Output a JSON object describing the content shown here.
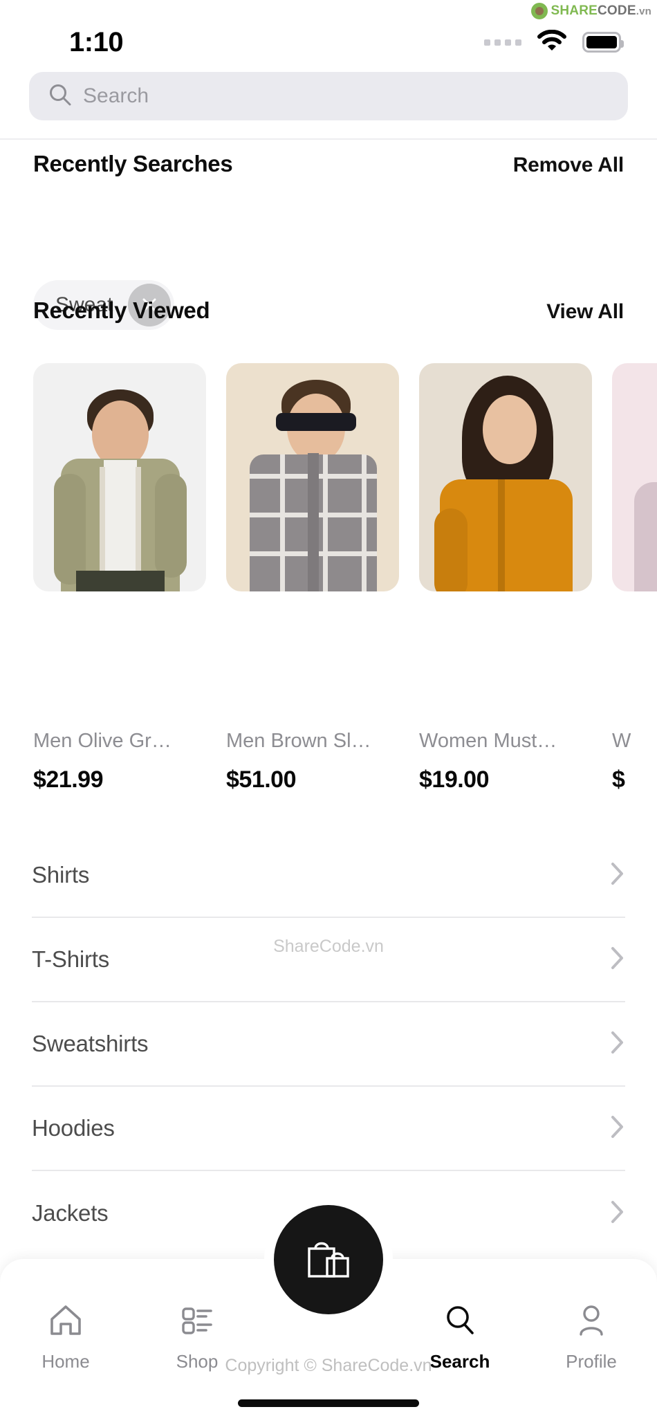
{
  "watermark": {
    "logo_share": "SHARE",
    "logo_code": "CODE",
    "logo_tld": ".vn",
    "logo_icon": "recycle-icon",
    "top_text": "ShareCode.vn",
    "bottom_text": "Copyright © ShareCode.vn"
  },
  "statusbar": {
    "time": "1:10",
    "signal_icon": "signal-dots-icon",
    "wifi_icon": "wifi-icon",
    "battery_icon": "battery-full-icon"
  },
  "search": {
    "placeholder": "Search",
    "value": "",
    "icon": "search-icon"
  },
  "recent_searches": {
    "title": "Recently Searches",
    "action": "Remove All",
    "chips": [
      {
        "label": "Sweat",
        "close_icon": "close-icon"
      }
    ]
  },
  "recently_viewed": {
    "title": "Recently Viewed",
    "action": "View All",
    "products": [
      {
        "title": "Men Olive Gr…",
        "price": "$21.99",
        "bg": "#f1f1f1",
        "garment": "#a7a581",
        "skin": "#e0b392",
        "hair": "#3a2a1e"
      },
      {
        "title": "Men Brown Sl…",
        "price": "$51.00",
        "bg": "#ece0cd",
        "garment": "#8e8a8c",
        "skin": "#e6bd9c",
        "hair": "#4a3422"
      },
      {
        "title": "Women Must…",
        "price": "$19.00",
        "bg": "#e6ded2",
        "garment": "#d8890f",
        "skin": "#e8c1a1",
        "hair": "#2e1f16"
      },
      {
        "title": "W",
        "price": "$",
        "bg": "#f3e4e8",
        "garment": "#d6c3cb",
        "skin": "#e9c6aa",
        "hair": "#35231a"
      }
    ]
  },
  "categories": [
    {
      "name": "Shirts",
      "chevron": "chevron-right-icon"
    },
    {
      "name": "T-Shirts",
      "chevron": "chevron-right-icon"
    },
    {
      "name": "Sweatshirts",
      "chevron": "chevron-right-icon"
    },
    {
      "name": "Hoodies",
      "chevron": "chevron-right-icon"
    },
    {
      "name": "Jackets",
      "chevron": "chevron-right-icon"
    }
  ],
  "bottom_nav": {
    "items": [
      {
        "label": "Home",
        "icon": "home-icon",
        "active": false
      },
      {
        "label": "Shop",
        "icon": "list-icon",
        "active": false
      },
      {
        "label": "Search",
        "icon": "search-icon",
        "active": true
      },
      {
        "label": "Profile",
        "icon": "user-icon",
        "active": false
      }
    ],
    "fab_icon": "shopping-bags-icon"
  },
  "colors": {
    "accent": "#161616",
    "search_bg": "#eaeaef",
    "chip_bg": "#f4f4f6",
    "chip_close_bg": "#c6c6c8",
    "muted_text": "#8d8d92",
    "divider": "#e8e8ea"
  }
}
